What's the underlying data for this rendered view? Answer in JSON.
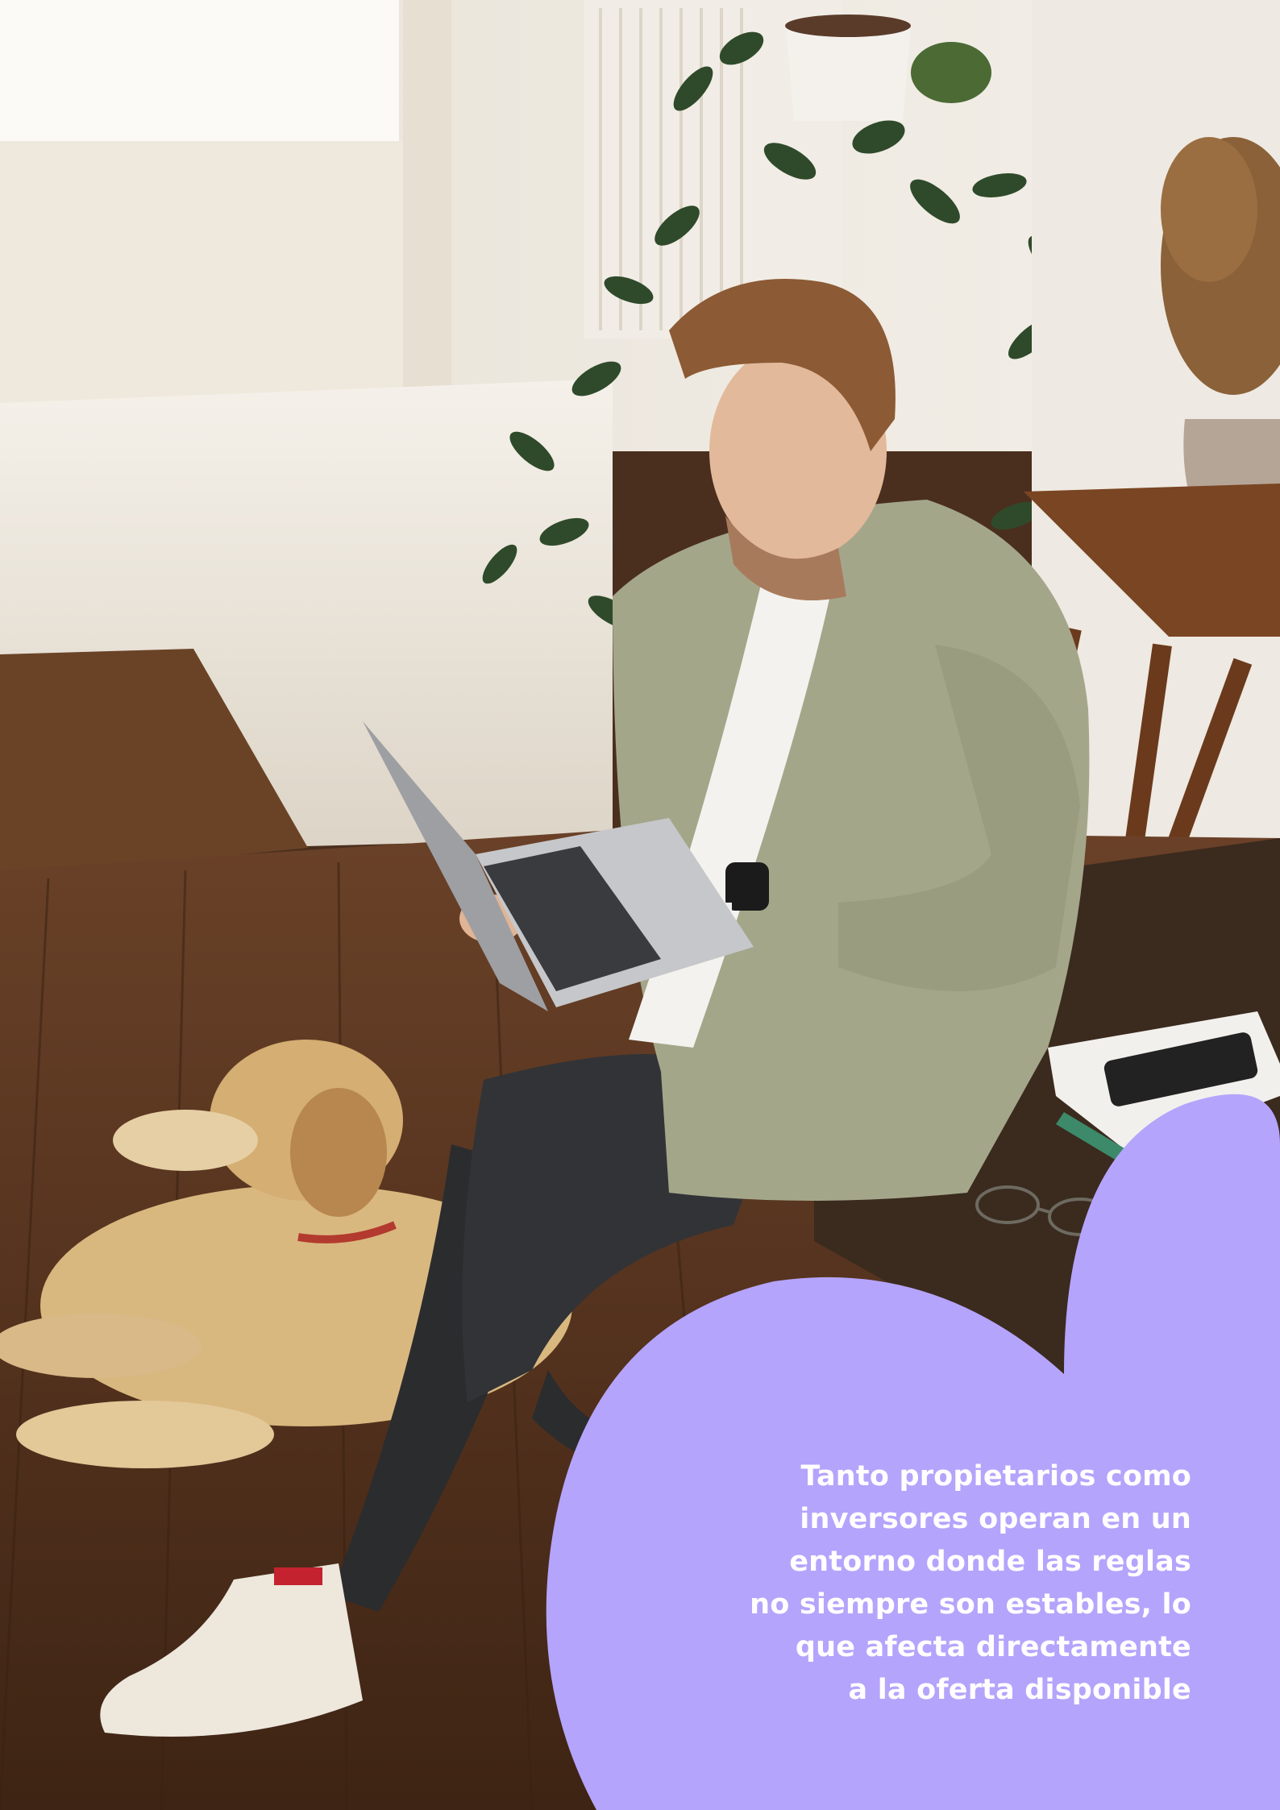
{
  "quote": {
    "lines": [
      "Tanto propietarios como",
      "inversores operan en un",
      "entorno donde las reglas",
      "no siempre son estables, lo",
      "que afecta directamente",
      "a la oferta disponible"
    ]
  },
  "colors": {
    "accent_blob": "#b5a4fc",
    "quote_text": "#ffffff",
    "wall": "#efe9e1",
    "floor": "#5a3620",
    "jacket": "#a4a68a",
    "jeans": "#2b2c2e",
    "dog": "#d8b77f"
  },
  "photo": {
    "subject": "man-with-laptop",
    "elements": [
      "window",
      "radiator",
      "plant",
      "dried-flowers-vase",
      "side-table",
      "rug",
      "wooden-floor",
      "golden-retriever",
      "laptop",
      "smartwatch",
      "notebook",
      "phone",
      "eyeglasses",
      "sneakers",
      "bench"
    ]
  }
}
